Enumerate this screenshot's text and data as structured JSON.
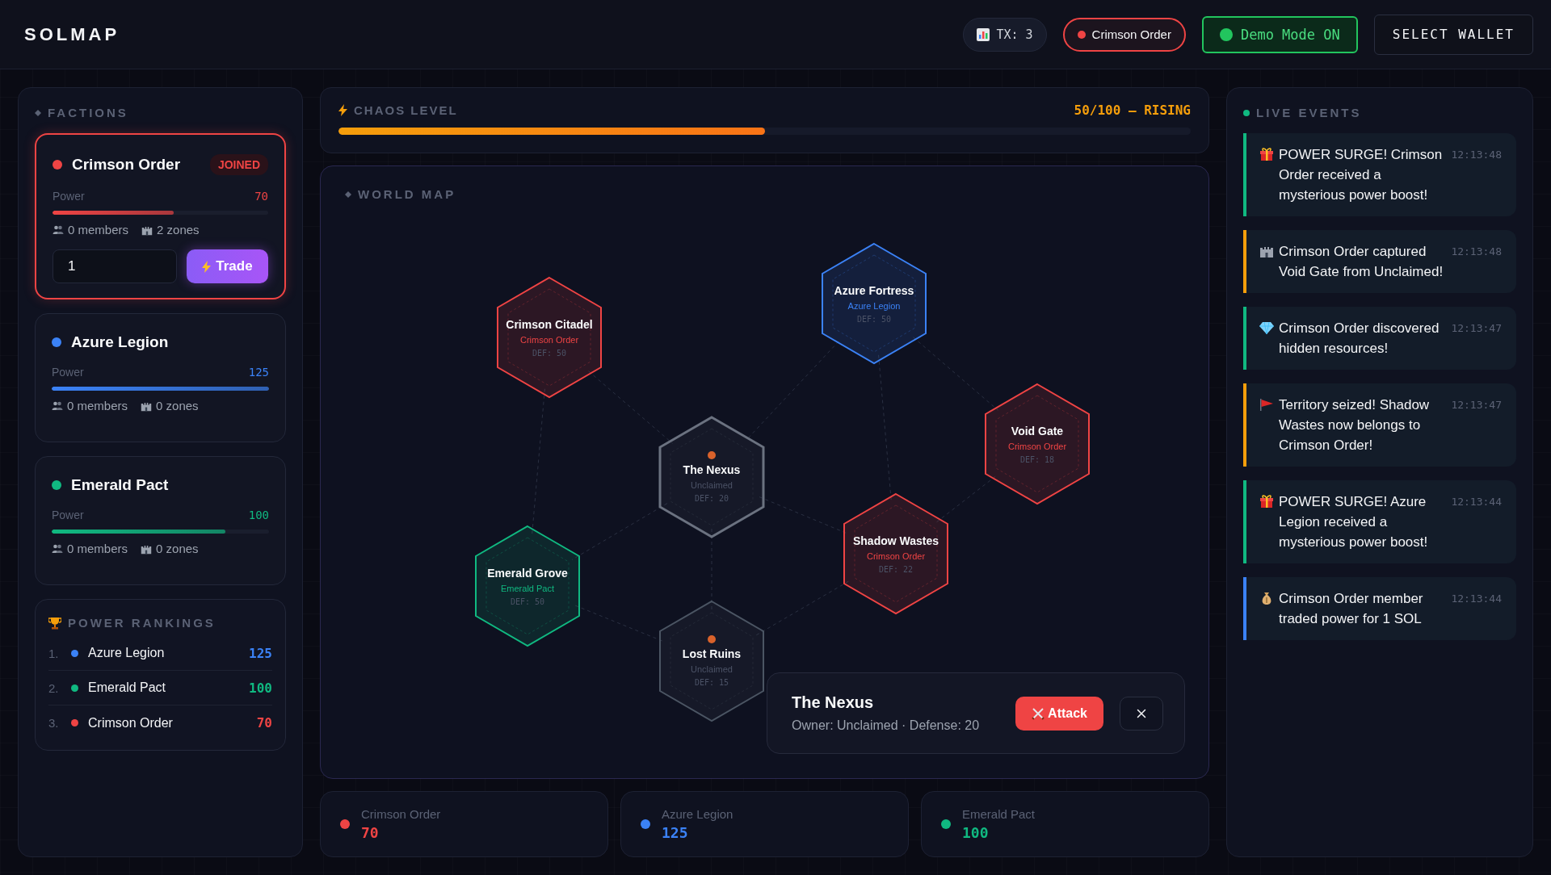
{
  "app": {
    "title": "SOLMAP"
  },
  "header": {
    "tx": "TX: 3",
    "faction": {
      "name": "Crimson Order",
      "color": "#ef4444"
    },
    "demo": {
      "label": "Demo Mode ON",
      "on": true
    },
    "wallet_button": "SELECT WALLET"
  },
  "factions": {
    "title": "FACTIONS",
    "items": [
      {
        "name": "Crimson Order",
        "color": "#ef4444",
        "badge": "JOINED",
        "selected": true,
        "power_label": "Power",
        "power": "70",
        "level": 0.56,
        "members": "0 members",
        "zones": "2 zones",
        "trade": {
          "amount": "1",
          "button": "Trade"
        }
      },
      {
        "name": "Azure Legion",
        "color": "#3b82f6",
        "selected": false,
        "power_label": "Power",
        "power": "125",
        "level": 1.0,
        "members": "0 members",
        "zones": "0 zones"
      },
      {
        "name": "Emerald Pact",
        "color": "#10b981",
        "selected": false,
        "power_label": "Power",
        "power": "100",
        "level": 0.8,
        "members": "0 members",
        "zones": "0 zones"
      }
    ]
  },
  "rankings": {
    "title": "POWER RANKINGS",
    "items": [
      {
        "rank": "1.",
        "name": "Azure Legion",
        "color": "#3b82f6",
        "power": "125"
      },
      {
        "rank": "2.",
        "name": "Emerald Pact",
        "color": "#10b981",
        "power": "100"
      },
      {
        "rank": "3.",
        "name": "Crimson Order",
        "color": "#ef4444",
        "power": "70"
      }
    ]
  },
  "chaos": {
    "title": "CHAOS LEVEL",
    "reading": "50/100 — RISING",
    "level": 0.5
  },
  "map": {
    "title": "WORLD MAP",
    "territories": [
      {
        "name": "Crimson Citadel",
        "owner": "Crimson Order",
        "defense": "DEF: 50",
        "color": "#ef4444",
        "selected": false,
        "alert": false
      },
      {
        "name": "Azure Fortress",
        "owner": "Azure Legion",
        "defense": "DEF: 50",
        "color": "#3b82f6",
        "selected": false,
        "alert": false
      },
      {
        "name": "The Nexus",
        "owner": "Unclaimed",
        "defense": "DEF: 20",
        "color": "#4b5563",
        "selected": true,
        "alert": true
      },
      {
        "name": "Void Gate",
        "owner": "Crimson Order",
        "defense": "DEF: 18",
        "color": "#ef4444",
        "selected": false,
        "alert": false
      },
      {
        "name": "Shadow Wastes",
        "owner": "Crimson Order",
        "defense": "DEF: 22",
        "color": "#ef4444",
        "selected": false,
        "alert": false
      },
      {
        "name": "Emerald Grove",
        "owner": "Emerald Pact",
        "defense": "DEF: 50",
        "color": "#10b981",
        "selected": false,
        "alert": false
      },
      {
        "name": "Lost Ruins",
        "owner": "Unclaimed",
        "defense": "DEF: 15",
        "color": "#4b5563",
        "selected": false,
        "alert": true
      }
    ],
    "info": {
      "title": "The Nexus",
      "details": "Owner: Unclaimed · Defense: 20",
      "attack_button": "Attack"
    }
  },
  "totals": [
    {
      "name": "Crimson Order",
      "color": "#ef4444",
      "power": "70"
    },
    {
      "name": "Azure Legion",
      "color": "#3b82f6",
      "power": "125"
    },
    {
      "name": "Emerald Pact",
      "color": "#10b981",
      "power": "100"
    }
  ],
  "events": {
    "title": "LIVE EVENTS",
    "items": [
      {
        "kind": "surge",
        "text": "POWER SURGE! Crimson Order received a mysterious power boost!",
        "time": "12:13:48",
        "color": "#10b981"
      },
      {
        "kind": "capture",
        "text": "Crimson Order captured Void Gate from Unclaimed!",
        "time": "12:13:48",
        "color": "#f59e0b"
      },
      {
        "kind": "discover",
        "text": "Crimson Order discovered hidden resources!",
        "time": "12:13:47",
        "color": "#10b981"
      },
      {
        "kind": "seize",
        "text": "Territory seized! Shadow Wastes now belongs to Crimson Order!",
        "time": "12:13:47",
        "color": "#f59e0b"
      },
      {
        "kind": "surge",
        "text": "POWER SURGE! Azure Legion received a mysterious power boost!",
        "time": "12:13:44",
        "color": "#10b981"
      },
      {
        "kind": "trade",
        "text": "Crimson Order member traded power for 1 SOL",
        "time": "12:13:44",
        "color": "#3b82f6"
      }
    ]
  }
}
